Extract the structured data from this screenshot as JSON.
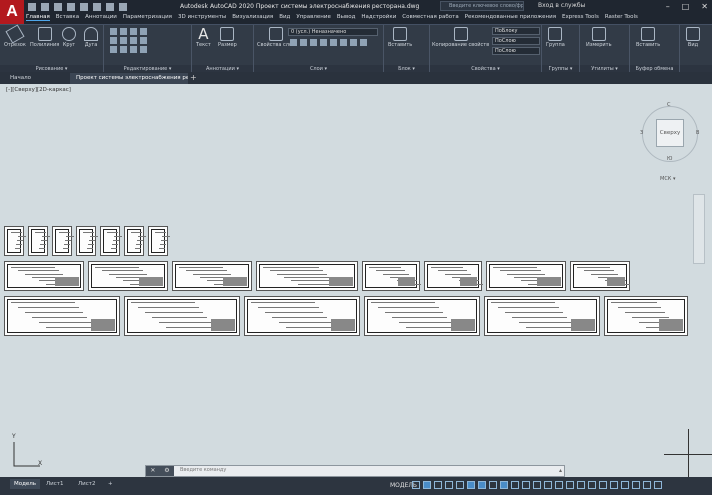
{
  "app": {
    "logo": "A",
    "title": "Autodesk AutoCAD 2020   Проект системы электроснабжения ресторана.dwg",
    "search_placeholder": "Введите ключевое слово/фразу",
    "signin": "Вход в службы",
    "window_controls": [
      "–",
      "□",
      "✕"
    ]
  },
  "menu_tabs": [
    "Главная",
    "Вставка",
    "Аннотации",
    "Параметризация",
    "3D инструменты",
    "Визуализация",
    "Вид",
    "Управление",
    "Вывод",
    "Надстройки",
    "Совместная работа",
    "Рекомендованные приложения",
    "Express Tools",
    "Raster Tools"
  ],
  "ribbon": {
    "groups": [
      {
        "label": "Рисование ▾",
        "tools": [
          "Отрезок",
          "Полилиния",
          "Круг",
          "Дуга"
        ]
      },
      {
        "label": "Редактирование ▾",
        "tools": []
      },
      {
        "label": "Аннотации ▾",
        "tools": [
          "Текст",
          "Размер"
        ]
      },
      {
        "label": "Слои ▾",
        "tools": [
          "Свойства слоя"
        ]
      },
      {
        "label": "Блок ▾",
        "tools": [
          "Вставить"
        ]
      },
      {
        "label": "Свойства ▾",
        "tools": [
          "Копирование свойств"
        ]
      },
      {
        "label": "Группы ▾",
        "tools": [
          "Группа"
        ]
      },
      {
        "label": "Утилиты ▾",
        "tools": [
          "Измерить"
        ]
      },
      {
        "label": "Буфер обмена",
        "tools": [
          "Вставить"
        ]
      },
      {
        "label": "",
        "tools": [
          "Вид"
        ]
      }
    ],
    "layer_combo": "0 (усл.) Неназначено",
    "prop_combos": [
      "ПоБлоку",
      "ПоСлою",
      "ПоСлою"
    ]
  },
  "file_tabs": [
    "Начало",
    "Проект системы электроснабжения ресторана*"
  ],
  "viewport": {
    "label": "[-][Сверху][2D-каркас]",
    "viewcube_face": "Сверху",
    "compass": {
      "n": "С",
      "s": "Ю",
      "w": "З",
      "e": "В"
    },
    "wcs": "МСК ▾"
  },
  "ucs": {
    "x": "X",
    "y": "Y"
  },
  "command_line": {
    "placeholder": "Введите команду",
    "buttons": [
      "✕",
      "🔧"
    ]
  },
  "status": {
    "layout_tabs": [
      "Модель",
      "Лист1",
      "Лист2",
      "+"
    ],
    "model": "МОДЕЛЬ"
  }
}
